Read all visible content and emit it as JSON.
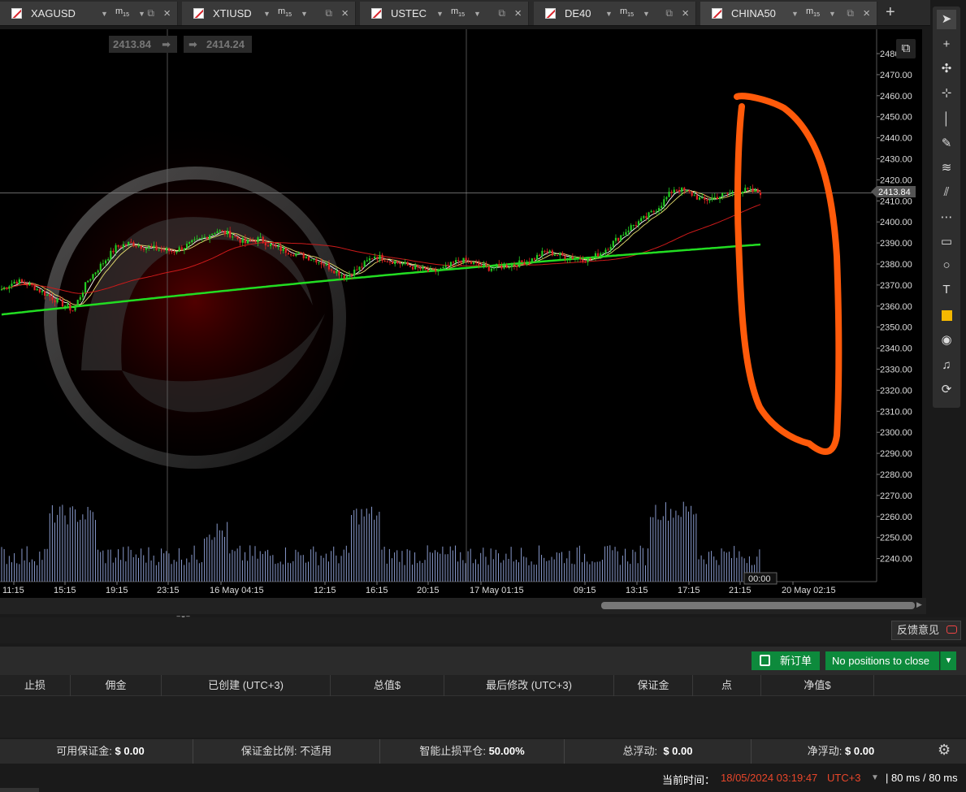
{
  "tabs": [
    {
      "symbol": "XAGUSD",
      "timeframe": "m",
      "timeframe_sub": "15"
    },
    {
      "symbol": "XTIUSD",
      "timeframe": "m",
      "timeframe_sub": "15"
    },
    {
      "symbol": "USTEC",
      "timeframe": "m",
      "timeframe_sub": "15"
    },
    {
      "symbol": "DE40",
      "timeframe": "m",
      "timeframe_sub": "15"
    },
    {
      "symbol": "CHINA50",
      "timeframe": "m",
      "timeframe_sub": "15"
    }
  ],
  "quote": {
    "bid": "2413.84",
    "ask": "2414.24"
  },
  "chart_data": {
    "type": "candlestick",
    "price_axis": [
      "2480.00",
      "2470.00",
      "2460.00",
      "2450.00",
      "2440.00",
      "2430.00",
      "2420.00",
      "2410.00",
      "2400.00",
      "2390.00",
      "2380.00",
      "2370.00",
      "2360.00",
      "2350.00",
      "2340.00",
      "2330.00",
      "2320.00",
      "2310.00",
      "2300.00",
      "2290.00",
      "2280.00",
      "2270.00",
      "2260.00",
      "2250.00",
      "2240.00"
    ],
    "current_price_label": "2413.84",
    "time_axis": [
      "11:15",
      "15:15",
      "19:15",
      "23:15",
      "16 May 04:15",
      "12:15",
      "16:15",
      "20:15",
      "17 May 01:15",
      "09:15",
      "13:15",
      "17:15",
      "21:15",
      "20 May 02:15"
    ],
    "countdown": "00:00",
    "close_series": [
      2368,
      2372,
      2370,
      2366,
      2362,
      2358,
      2372,
      2380,
      2388,
      2390,
      2388,
      2387,
      2386,
      2389,
      2392,
      2396,
      2394,
      2390,
      2392,
      2388,
      2386,
      2384,
      2382,
      2378,
      2374,
      2378,
      2384,
      2382,
      2380,
      2378,
      2376,
      2378,
      2382,
      2380,
      2378,
      2379,
      2380,
      2382,
      2386,
      2384,
      2383,
      2382,
      2386,
      2392,
      2398,
      2402,
      2408,
      2416,
      2414,
      2410,
      2412,
      2414,
      2415,
      2414
    ],
    "ylim": [
      2235,
      2484
    ]
  },
  "toolbar": {
    "icons": [
      "cursor-icon",
      "crosshair-icon",
      "cross-arrows-icon",
      "zoom-icon",
      "vertical-line-icon",
      "pen-icon",
      "fibonacci-icon",
      "channel-icon",
      "grid-icon",
      "rectangle-icon",
      "circle-icon",
      "text-icon",
      "color-swatch-icon",
      "camera-icon",
      "alert-bell-icon",
      "replay-icon"
    ],
    "swatch_color": "#f5b800"
  },
  "feedback_label": "反馈意见",
  "new_order_label": "新订单",
  "no_positions_label": "No positions to close",
  "table_headers": [
    "止损",
    "佣金",
    "已创建 (UTC+3)",
    "总值$",
    "最后修改 (UTC+3)",
    "保证金",
    "点",
    "净值$"
  ],
  "account": {
    "free_margin_label": "可用保证金:",
    "free_margin": "$ 0.00",
    "margin_level_label": "保证金比例:",
    "margin_level": "不适用",
    "stop_out_label": "智能止损平仓:",
    "stop_out": "50.00%",
    "floating_label": "总浮动:",
    "floating": "$ 0.00",
    "net_floating_label": "净浮动:",
    "net_floating": "$ 0.00"
  },
  "status": {
    "time_label": "当前时间：",
    "time": "18/05/2024 03:19:47",
    "tz": "UTC+3",
    "latency": "80 ms / 80 ms"
  },
  "colors": {
    "accent_green": "#0d8a3c",
    "annotation": "#ff5a0a",
    "time_red": "#e8462a"
  }
}
